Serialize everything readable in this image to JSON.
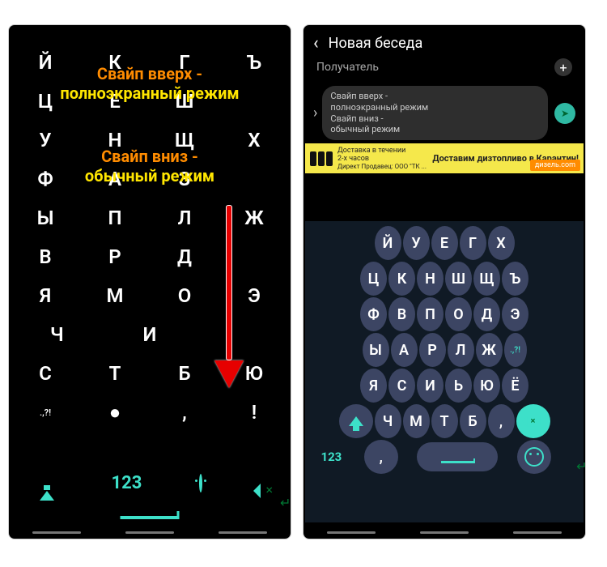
{
  "left": {
    "rows": [
      [
        "Й",
        "К",
        "Г",
        "Ъ"
      ],
      [
        "Ц",
        "Е",
        "Ш",
        ""
      ],
      [
        "У",
        "Н",
        "Щ",
        "Х"
      ],
      [
        "Ф",
        "А",
        "З",
        ""
      ],
      [
        "Ы",
        "П",
        "Л",
        "Ж"
      ],
      [
        "В",
        "Р",
        "Д",
        ""
      ],
      [
        "Я",
        "М",
        "О",
        "Э"
      ],
      [
        "Ч",
        "И",
        ""
      ],
      [
        "С",
        "Т",
        "Б",
        "Ю"
      ],
      [
        ".,?!",
        "●",
        ",",
        "!"
      ]
    ],
    "anno1_a": "Свайп вверх -",
    "anno1_b": "полноэкранный режим",
    "anno2_a": "Свайп вниз -",
    "anno2_b": "обычный режим",
    "numkey": "123"
  },
  "right": {
    "header": "Новая беседа",
    "recipient_placeholder": "Получатель",
    "bubble_l1": "Свайп вверх -",
    "bubble_l2": "полноэкранный режим",
    "bubble_l3": "Свайп вниз -",
    "bubble_l4": "обычный режим",
    "ad_title": "Доставим дизтопливо в Карантин!",
    "ad_sub1": "Доставка в течении",
    "ad_sub2": "2-х часов",
    "ad_seller": "Директ  Продавец: ООО \"ТК ...",
    "ad_button": "дизель.com",
    "kbd": {
      "r1": [
        "Й",
        "У",
        "Е",
        "Г",
        "Х"
      ],
      "r2": [
        "Ц",
        "К",
        "Н",
        "Ш",
        "Щ",
        "Ъ"
      ],
      "r3": [
        "Ф",
        "В",
        "П",
        "О",
        "Д",
        "Э"
      ],
      "r4": [
        "Ы",
        "А",
        "Р",
        "Л",
        "Ж"
      ],
      "r4_sym": ".,?!",
      "r5": [
        "Я",
        "С",
        "И",
        "Ь",
        "Ю",
        "Ё"
      ],
      "r6": [
        "Ч",
        "М",
        "Т",
        "Б",
        ","
      ],
      "num": "123"
    }
  }
}
